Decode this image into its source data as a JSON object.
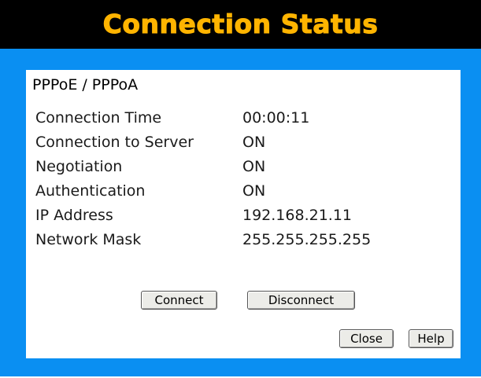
{
  "window": {
    "title": "Connection Status"
  },
  "section": {
    "title": "PPPoE / PPPoA"
  },
  "info": [
    {
      "label": "Connection Time",
      "value": "00:00:11"
    },
    {
      "label": "Connection to Server",
      "value": "ON"
    },
    {
      "label": "Negotiation",
      "value": "ON"
    },
    {
      "label": "Authentication",
      "value": "ON"
    },
    {
      "label": "IP Address",
      "value": "192.168.21.11"
    },
    {
      "label": "Network Mask",
      "value": "255.255.255.255"
    }
  ],
  "buttons": {
    "connect": "Connect",
    "disconnect": "Disconnect",
    "close": "Close",
    "help": "Help"
  },
  "colors": {
    "titlebar_bg": "#000000",
    "title_text": "#ffb400",
    "frame_bg": "#0a8ff2",
    "panel_bg": "#ffffff"
  }
}
